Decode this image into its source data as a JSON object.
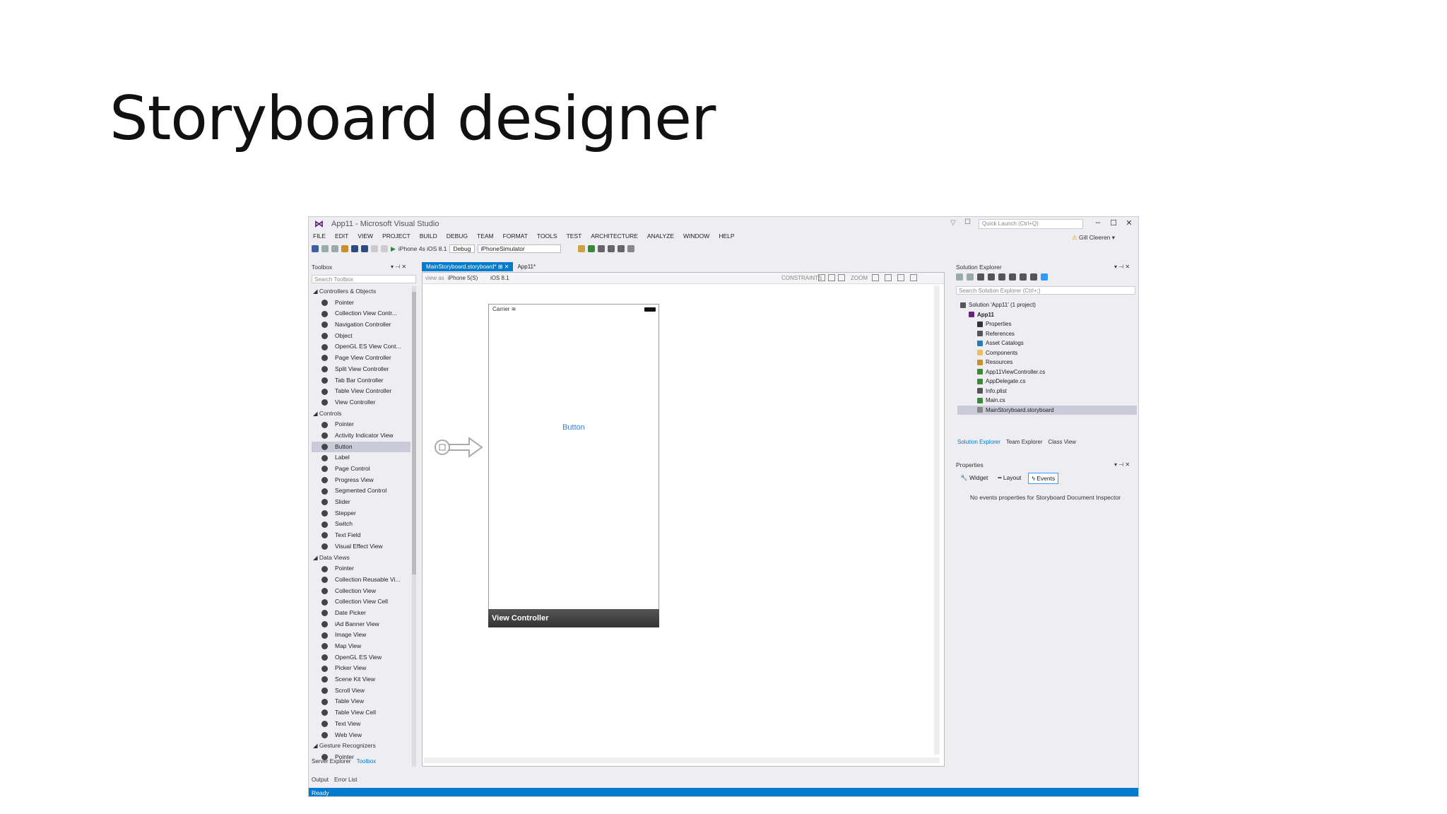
{
  "slide_title": "Storyboard designer",
  "window": {
    "title": "App11 - Microsoft Visual Studio",
    "quick_launch_placeholder": "Quick Launch (Ctrl+Q)",
    "user": "Gill Cleeren",
    "menu": [
      "FILE",
      "EDIT",
      "VIEW",
      "PROJECT",
      "BUILD",
      "DEBUG",
      "TEAM",
      "FORMAT",
      "TOOLS",
      "TEST",
      "ARCHITECTURE",
      "ANALYZE",
      "WINDOW",
      "HELP"
    ]
  },
  "toolbar": {
    "run_target": "iPhone 4s iOS 8.1",
    "config": "Debug",
    "platform": "iPhoneSimulator"
  },
  "toolbox": {
    "title": "Toolbox",
    "search_placeholder": "Search Toolbox",
    "sections": [
      {
        "name": "Controllers & Objects",
        "items": [
          "Pointer",
          "Collection View Contr...",
          "Navigation Controller",
          "Object",
          "OpenGL ES View Cont...",
          "Page View Controller",
          "Split View Controller",
          "Tab Bar Controller",
          "Table View Controller",
          "View Controller"
        ]
      },
      {
        "name": "Controls",
        "items": [
          "Pointer",
          "Activity Indicator View",
          "Button",
          "Label",
          "Page Control",
          "Progress View",
          "Segmented Control",
          "Slider",
          "Stepper",
          "Switch",
          "Text Field",
          "Visual Effect View"
        ]
      },
      {
        "name": "Data Views",
        "items": [
          "Pointer",
          "Collection Reusable Vi...",
          "Collection View",
          "Collection View Cell",
          "Date Picker",
          "iAd Banner View",
          "Image View",
          "Map View",
          "OpenGL ES View",
          "Picker View",
          "Scene Kit View",
          "Scroll View",
          "Table View",
          "Table View Cell",
          "Text View",
          "Web View"
        ]
      },
      {
        "name": "Gesture Recognizers",
        "items": [
          "Pointer"
        ]
      }
    ],
    "selected": "Button",
    "bottom_tabs": [
      "Server Explorer",
      "Toolbox"
    ]
  },
  "doc_tabs": [
    "MainStoryboard.storyboard*",
    "App11*"
  ],
  "designer": {
    "view_as_label": "view as",
    "device": "iPhone 5(S)",
    "os": "iOS 8.1",
    "constraints_label": "CONSTRAINTS",
    "zoom_label": "ZOOM",
    "carrier": "Carrier",
    "button_text": "Button",
    "controller_label": "View Controller"
  },
  "solution_explorer": {
    "title": "Solution Explorer",
    "search_placeholder": "Search Solution Explorer (Ctrl+;)",
    "tree": [
      {
        "label": "Solution 'App11' (1 project)",
        "indent": 0
      },
      {
        "label": "App11",
        "indent": 1
      },
      {
        "label": "Properties",
        "indent": 2
      },
      {
        "label": "References",
        "indent": 2
      },
      {
        "label": "Asset Catalogs",
        "indent": 2
      },
      {
        "label": "Components",
        "indent": 2
      },
      {
        "label": "Resources",
        "indent": 2
      },
      {
        "label": "App11ViewController.cs",
        "indent": 2
      },
      {
        "label": "AppDelegate.cs",
        "indent": 2
      },
      {
        "label": "Info.plist",
        "indent": 2
      },
      {
        "label": "Main.cs",
        "indent": 2
      },
      {
        "label": "MainStoryboard.storyboard",
        "indent": 2
      }
    ],
    "selected": "MainStoryboard.storyboard",
    "bottom_tabs": [
      "Solution Explorer",
      "Team Explorer",
      "Class View"
    ]
  },
  "properties": {
    "title": "Properties",
    "tabs": [
      "Widget",
      "Layout",
      "Events"
    ],
    "active_tab": "Events",
    "message": "No events properties for Storyboard Document Inspector"
  },
  "output_tabs": [
    "Output",
    "Error List"
  ],
  "status": "Ready",
  "colors": {
    "accent": "#007acc",
    "vs_purple": "#68217a"
  }
}
